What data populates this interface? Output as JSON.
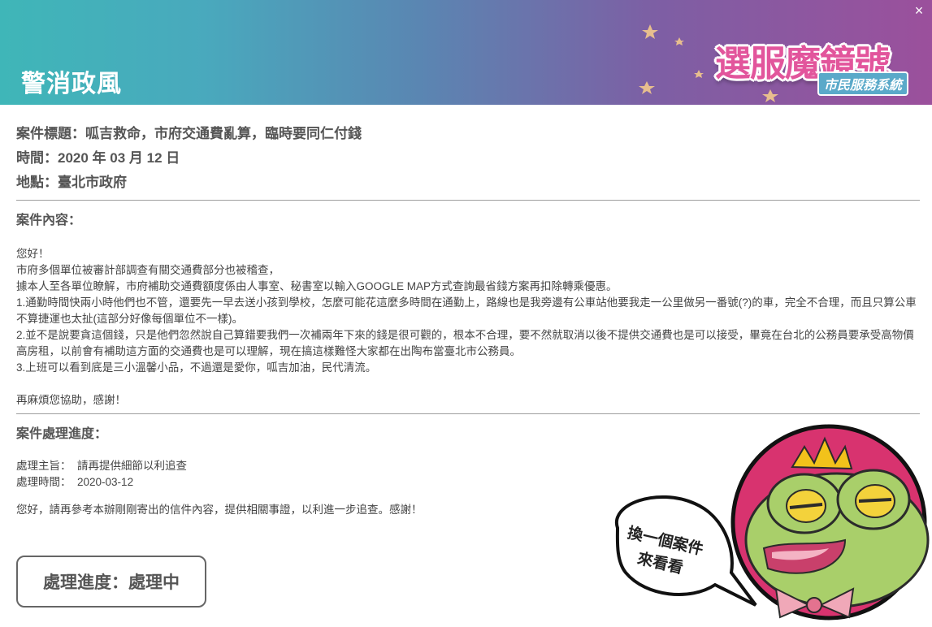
{
  "header": {
    "title": "警消政風",
    "close_label": "×",
    "logo_main": "選服魔鏡號",
    "logo_sub": "市民服務系統"
  },
  "case": {
    "title_label": "案件標題：",
    "title_value": "呱吉救命，市府交通費亂算，臨時要同仁付錢",
    "time_label": "時間：",
    "time_value": "2020 年 03 月 12 日",
    "place_label": "地點：",
    "place_value": "臺北市政府",
    "content_title": "案件內容：",
    "content_lines": [
      "您好！",
      "市府多個單位被審計部調查有關交通費部分也被稽查，",
      "據本人至各單位瞭解，市府補助交通費額度係由人事室、秘書室以輸入GOOGLE MAP方式查詢最省錢方案再扣除轉乘優惠。",
      "1.通勤時間快兩小時他們也不管，還要先一早去送小孩到學校，怎麼可能花這麼多時間在通勤上，路線也是我旁邊有公車站他要我走一公里做另一番號(?)的車，完全不合理，而且只算公車不算捷運也太扯(這部分好像每個單位不一樣)。",
      "2.並不是說要貪這個錢，只是他們忽然說自己算錯要我們一次補兩年下來的錢是很可觀的，根本不合理，要不然就取消以後不提供交通費也是可以接受，畢竟在台北的公務員要承受高物價高房租，以前會有補助這方面的交通費也是可以理解，現在搞這樣難怪大家都在出陶布當臺北市公務員。",
      "3.上班可以看到底是三小溫馨小品，不過還是愛你，呱吉加油，民代清流。",
      "",
      "再麻煩您協助，感謝！"
    ]
  },
  "progress": {
    "section_title": "案件處理進度：",
    "subject_label": "處理主旨：",
    "subject_value": "請再提供細節以利追查",
    "time_label": "處理時間：",
    "time_value": "2020-03-12",
    "reply": "您好，請再參考本辦剛剛寄出的信件內容，提供相關事證，以利進一步追查。感謝！",
    "status_label": "處理進度：",
    "status_value": "處理中"
  },
  "mascot": {
    "bubble_line1": "換一個案件",
    "bubble_line2": "來看看"
  },
  "colors": {
    "header_start": "#3fb6b8",
    "header_end": "#9b509c",
    "mascot_bg": "#d8336f",
    "frog_green": "#a9cf6a",
    "crown": "#f2c21b"
  }
}
